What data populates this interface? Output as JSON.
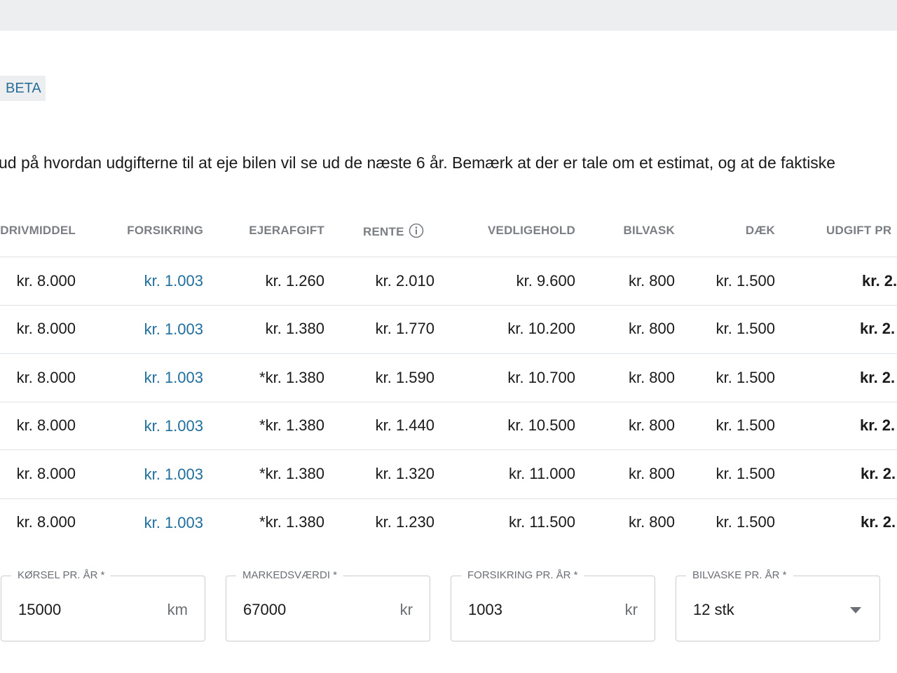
{
  "badge": "BETA",
  "intro": "ud på hvordan udgifterne til at eje bilen vil se ud de næste 6 år. Bemærk at der er tale om et estimat, og at de faktiske",
  "columns": {
    "drivmiddel": "DRIVMIDDEL",
    "forsikring": "FORSIKRING",
    "ejerafgift": "EJERAFGIFT",
    "rente": "RENTE",
    "vedligehold": "VEDLIGEHOLD",
    "bilvask": "BILVASK",
    "daek": "DÆK",
    "udgift": "UDGIFT PR"
  },
  "rows": [
    {
      "drivmiddel": "kr. 8.000",
      "forsikring": "kr. 1.003",
      "ejerafgift": "kr. 1.260",
      "rente": "kr. 2.010",
      "vedligehold": "kr. 9.600",
      "bilvask": "kr. 800",
      "daek": "kr. 1.500",
      "udgift": "kr. 2."
    },
    {
      "drivmiddel": "kr. 8.000",
      "forsikring": "kr. 1.003",
      "ejerafgift": "kr. 1.380",
      "rente": "kr. 1.770",
      "vedligehold": "kr. 10.200",
      "bilvask": "kr. 800",
      "daek": "kr. 1.500",
      "udgift": "kr. 2."
    },
    {
      "drivmiddel": "kr. 8.000",
      "forsikring": "kr. 1.003",
      "ejerafgift": "*kr. 1.380",
      "rente": "kr. 1.590",
      "vedligehold": "kr. 10.700",
      "bilvask": "kr. 800",
      "daek": "kr. 1.500",
      "udgift": "kr. 2."
    },
    {
      "drivmiddel": "kr. 8.000",
      "forsikring": "kr. 1.003",
      "ejerafgift": "*kr. 1.380",
      "rente": "kr. 1.440",
      "vedligehold": "kr. 10.500",
      "bilvask": "kr. 800",
      "daek": "kr. 1.500",
      "udgift": "kr. 2."
    },
    {
      "drivmiddel": "kr. 8.000",
      "forsikring": "kr. 1.003",
      "ejerafgift": "*kr. 1.380",
      "rente": "kr. 1.320",
      "vedligehold": "kr. 11.000",
      "bilvask": "kr. 800",
      "daek": "kr. 1.500",
      "udgift": "kr. 2."
    },
    {
      "drivmiddel": "kr. 8.000",
      "forsikring": "kr. 1.003",
      "ejerafgift": "*kr. 1.380",
      "rente": "kr. 1.230",
      "vedligehold": "kr. 11.500",
      "bilvask": "kr. 800",
      "daek": "kr. 1.500",
      "udgift": "kr. 2."
    }
  ],
  "fields": {
    "korsel": {
      "label": "KØRSEL PR. ÅR *",
      "value": "15000",
      "unit": "km"
    },
    "markedsvaerdi": {
      "label": "MARKEDSVÆRDI *",
      "value": "67000",
      "unit": "kr"
    },
    "forsikring": {
      "label": "FORSIKRING PR. ÅR *",
      "value": "1003",
      "unit": "kr"
    },
    "bilvaske": {
      "label": "BILVASKE PR. ÅR *",
      "value": "12 stk"
    }
  },
  "icons": {
    "rente_info": "info-icon",
    "bilvaske_dropdown": "chevron-down-icon"
  },
  "colors": {
    "link": "#1f6e9c",
    "header_text": "#7b7f84",
    "topbar": "#eceef0"
  }
}
